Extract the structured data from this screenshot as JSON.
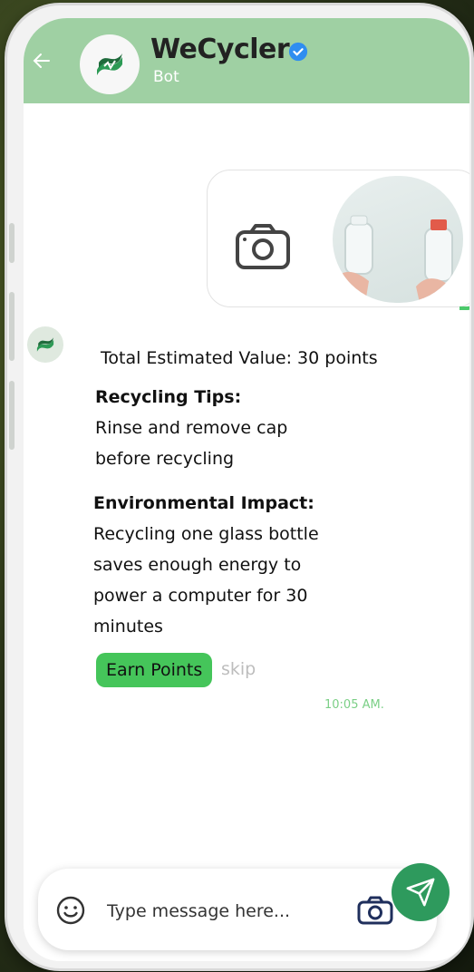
{
  "header": {
    "title": "WeCycler",
    "subtitle": "Bot",
    "accent_color": "#9fd0a3",
    "icons": [
      "back-arrow-icon",
      "wecycler-logo-icon",
      "verified-badge-icon"
    ]
  },
  "chat": {
    "attachment": {
      "icons": [
        "camera-icon"
      ],
      "photo": "glass-bottles-photo"
    },
    "bot_message": {
      "total_value": "Total Estimated Value: 30 points",
      "tips_heading": "Recycling Tips:",
      "tips_lines": [
        "Rinse and remove cap",
        "before recycling"
      ],
      "impact_heading": "Environmental Impact:",
      "impact_lines": [
        "Recycling one glass bottle",
        "saves enough energy to",
        "power a computer for 30",
        "minutes"
      ],
      "earn_label": "Earn Points",
      "skip_label": "skip",
      "timestamp": "10:05 AM."
    }
  },
  "composer": {
    "placeholder": "Type message here...",
    "icons": [
      "emoji-icon",
      "camera-icon",
      "send-icon"
    ],
    "send_color": "#2e9a5d"
  }
}
